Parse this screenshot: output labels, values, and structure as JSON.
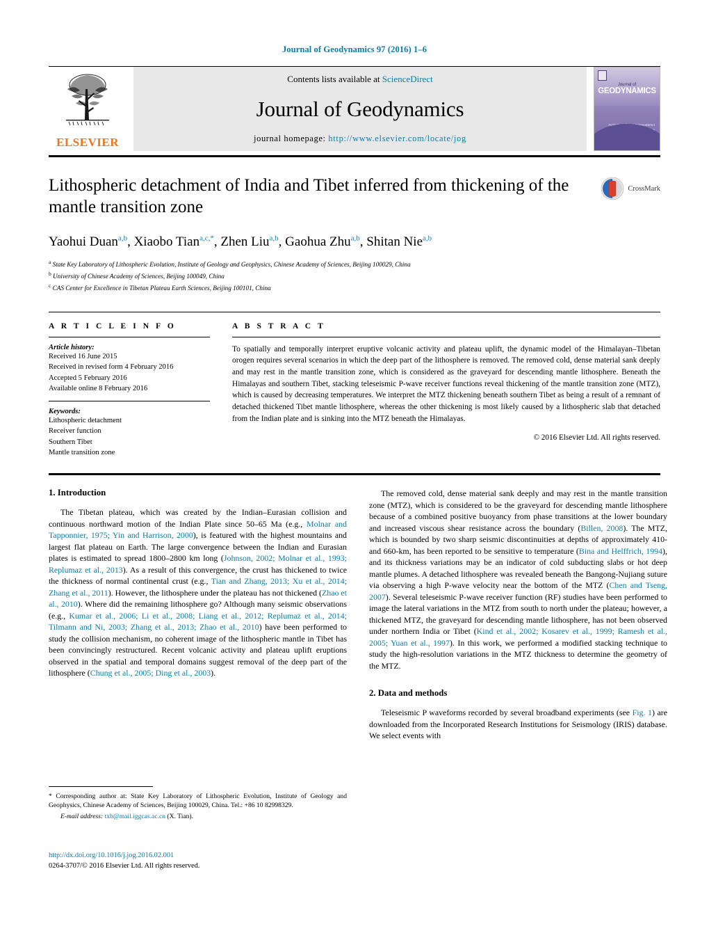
{
  "running_head": "Journal of Geodynamics 97 (2016) 1–6",
  "masthead": {
    "publisher_name": "ELSEVIER",
    "contents_prefix": "Contents lists available at ",
    "contents_link": "ScienceDirect",
    "journal_title": "Journal of Geodynamics",
    "homepage_label": "journal homepage: ",
    "homepage_url": "http://www.elsevier.com/locate/jog",
    "cover": {
      "journal_of": "Journal of",
      "name": "GEODYNAMICS",
      "sub_right": "Available online at\nScienceDirect\nwww.sciencedirect.com",
      "sub_left": "An International Journal"
    }
  },
  "article": {
    "title": "Lithospheric detachment of India and Tibet inferred from thickening of the mantle transition zone",
    "crossmark_label": "CrossMark",
    "authors": [
      {
        "name": "Yaohui Duan",
        "sup": "a,b",
        "sep": ", "
      },
      {
        "name": "Xiaobo Tian",
        "sup": "a,c,*",
        "sep": ", "
      },
      {
        "name": "Zhen Liu",
        "sup": "a,b",
        "sep": ", "
      },
      {
        "name": "Gaohua Zhu",
        "sup": "a,b",
        "sep": ", "
      },
      {
        "name": "Shitan Nie",
        "sup": "a,b",
        "sep": ""
      }
    ],
    "affiliations": [
      {
        "marker": "a",
        "text": "State Key Laboratory of Lithospheric Evolution, Institute of Geology and Geophysics, Chinese Academy of Sciences, Beijing 100029, China"
      },
      {
        "marker": "b",
        "text": "University of Chinese Academy of Sciences, Beijing 100049, China"
      },
      {
        "marker": "c",
        "text": "CAS Center for Excellence in Tibetan Plateau Earth Sciences, Beijing 100101, China"
      }
    ]
  },
  "article_info": {
    "heading": "A R T I C L E   I N F O",
    "history_label": "Article history:",
    "history": [
      "Received 16 June 2015",
      "Received in revised form 4 February 2016",
      "Accepted 5 February 2016",
      "Available online 8 February 2016"
    ],
    "keywords_label": "Keywords:",
    "keywords": [
      "Lithospheric detachment",
      "Receiver function",
      "Southern Tibet",
      "Mantle transition zone"
    ]
  },
  "abstract": {
    "heading": "A B S T R A C T",
    "text": "To spatially and temporally interpret eruptive volcanic activity and plateau uplift, the dynamic model of the Himalayan–Tibetan orogen requires several scenarios in which the deep part of the lithosphere is removed. The removed cold, dense material sank deeply and may rest in the mantle transition zone, which is considered as the graveyard for descending mantle lithosphere. Beneath the Himalayas and southern Tibet, stacking teleseismic P-wave receiver functions reveal thickening of the mantle transition zone (MTZ), which is caused by decreasing temperatures. We interpret the MTZ thickening beneath southern Tibet as being a result of a remnant of detached thickened Tibet mantle lithosphere, whereas the other thickening is most likely caused by a lithospheric slab that detached from the Indian plate and is sinking into the MTZ beneath the Himalayas.",
    "copyright": "© 2016 Elsevier Ltd. All rights reserved."
  },
  "sections": {
    "intro_heading": "1. Introduction",
    "methods_heading": "2. Data and methods"
  },
  "body": {
    "left_para1": [
      {
        "t": "The Tibetan plateau, which was created by the Indian–Eurasian collision and continuous northward motion of the Indian Plate since 50–65 Ma (e.g., ",
        "link": false
      },
      {
        "t": "Molnar and Tapponnier, 1975; Yin and Harrison, 2000",
        "link": true
      },
      {
        "t": "), is featured with the highest mountains and largest flat plateau on Earth. The large convergence between the Indian and Eurasian plates is estimated to spread 1800–2800 km long (",
        "link": false
      },
      {
        "t": "Johnson, 2002; Molnar et al., 1993; Replumaz et al., 2013",
        "link": true
      },
      {
        "t": "). As a result of this convergence, the crust has thickened to twice the thickness of normal continental crust (e.g., ",
        "link": false
      },
      {
        "t": "Tian and Zhang, 2013; Xu et al., 2014; Zhang et al., 2011",
        "link": true
      },
      {
        "t": "). However, the lithosphere under the plateau has not thickened (",
        "link": false
      },
      {
        "t": "Zhao et al., 2010",
        "link": true
      },
      {
        "t": "). Where did the remaining lithosphere go? Although many seismic observations (e.g., ",
        "link": false
      },
      {
        "t": "Kumar et al., 2006; Li et al., 2008; Liang et al., 2012; Replumaz et al., 2014; Tilmann and Ni, 2003; Zhang et al., 2013; Zhao et al., 2010",
        "link": true
      },
      {
        "t": ") have been performed to study the collision mechanism, no coherent image of the lithospheric mantle in Tibet has been convincingly restructured. Recent volcanic activity and plateau uplift eruptions observed in the spatial and temporal domains suggest removal of the deep part of the lithosphere (",
        "link": false
      },
      {
        "t": "Chung et al., 2005; Ding et al., 2003",
        "link": true
      },
      {
        "t": ").",
        "link": false
      }
    ],
    "right_para1": [
      {
        "t": "The removed cold, dense material sank deeply and may rest in the mantle transition zone (MTZ), which is considered to be the graveyard for descending mantle lithosphere because of a combined positive buoyancy from phase transitions at the lower boundary and increased viscous shear resistance across the boundary (",
        "link": false
      },
      {
        "t": "Billen, 2008",
        "link": true
      },
      {
        "t": "). The MTZ, which is bounded by two sharp seismic discontinuities at depths of approximately 410- and 660-km, has been reported to be sensitive to temperature (",
        "link": false
      },
      {
        "t": "Bina and Helffrich, 1994",
        "link": true
      },
      {
        "t": "), and its thickness variations may be an indicator of cold subducting slabs or hot deep mantle plumes. A detached lithosphere was revealed beneath the Bangong-Nujiang suture via observing a high P-wave velocity near the bottom of the MTZ (",
        "link": false
      },
      {
        "t": "Chen and Tseng, 2007",
        "link": true
      },
      {
        "t": "). Several teleseismic P-wave receiver function (RF) studies have been performed to image the lateral variations in the MTZ from south to north under the plateau; however, a thickened MTZ, the graveyard for descending mantle lithosphere, has not been observed under northern India or Tibet (",
        "link": false
      },
      {
        "t": "Kind et al., 2002; Kosarev et al., 1999; Ramesh et al., 2005; Yuan et al., 1997",
        "link": true
      },
      {
        "t": "). In this work, we performed a modified stacking technique to study the high-resolution variations in the MTZ thickness to determine the geometry of the MTZ.",
        "link": false
      }
    ],
    "right_para2": [
      {
        "t": "Teleseismic P waveforms recorded by several broadband experiments (see ",
        "link": false
      },
      {
        "t": "Fig. 1",
        "link": true
      },
      {
        "t": ") are downloaded from the Incorporated Research Institutions for Seismology (IRIS) database. We select events with",
        "link": false
      }
    ]
  },
  "footnote": {
    "star": "*",
    "corresponding": " Corresponding author at: State Key Laboratory of Lithospheric Evolution, Institute of Geology and Geophysics, Chinese Academy of Sciences, Beijing 100029, China. Tel.: +86 10 82998329.",
    "email_label": "E-mail address:",
    "email": "txb@mail.iggcas.ac.cn",
    "email_suffix": " (X. Tian)."
  },
  "doi_block": {
    "doi": "http://dx.doi.org/10.1016/j.jog.2016.02.001",
    "issn_line": "0264-3707/© 2016 Elsevier Ltd. All rights reserved."
  },
  "colors": {
    "link": "#0b7ca8",
    "elsevier_orange": "#e87722",
    "banner_gray": "#e8e8e8"
  }
}
